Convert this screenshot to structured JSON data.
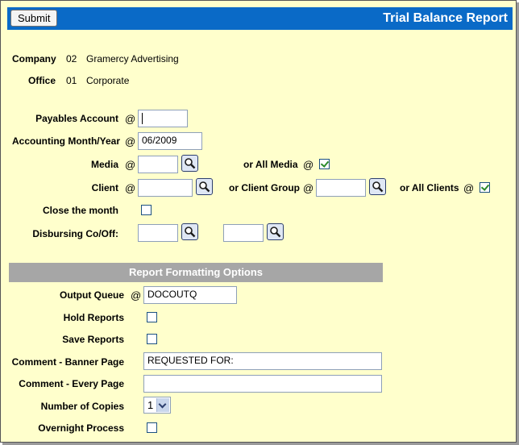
{
  "header": {
    "submit_label": "Submit",
    "title": "Trial Balance Report"
  },
  "company": {
    "label": "Company",
    "code": "02",
    "name": "Gramercy Advertising"
  },
  "office": {
    "label": "Office",
    "code": "01",
    "name": "Corporate"
  },
  "at_symbol": "@",
  "payables_account": {
    "label": "Payables Account",
    "value": ""
  },
  "accounting_month": {
    "label": "Accounting Month/Year",
    "value": "06/2009"
  },
  "media": {
    "label": "Media",
    "value": "",
    "all_label": "or All Media",
    "all_checked": true
  },
  "client": {
    "label": "Client",
    "value": "",
    "group_label": "or Client Group",
    "group_value": "",
    "all_label": "or All Clients",
    "all_checked": true
  },
  "close_month": {
    "label": "Close the month",
    "checked": false
  },
  "disbursing": {
    "label": "Disbursing Co/Off:",
    "value1": "",
    "value2": ""
  },
  "formatting": {
    "section_title": "Report Formatting Options",
    "output_queue": {
      "label": "Output Queue",
      "value": "DOCOUTQ"
    },
    "hold_reports": {
      "label": "Hold Reports",
      "checked": false
    },
    "save_reports": {
      "label": "Save Reports",
      "checked": false
    },
    "comment_banner": {
      "label": "Comment - Banner Page",
      "value": "REQUESTED FOR:"
    },
    "comment_every": {
      "label": "Comment - Every Page",
      "value": ""
    },
    "copies": {
      "label": "Number of Copies",
      "selected": "1"
    },
    "overnight": {
      "label": "Overnight Process",
      "checked": false
    }
  },
  "icons": {
    "lookup": "magnifier-icon",
    "dropdown": "chevron-down-icon",
    "check": "checkmark-icon"
  },
  "colors": {
    "header_bg": "#0a6ac7",
    "page_bg": "#ffffcc",
    "section_bg": "#a6a6a6"
  }
}
